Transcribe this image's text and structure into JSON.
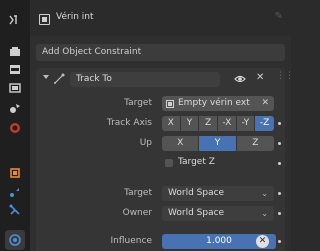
{
  "header": {
    "object_name": "Vérin int"
  },
  "add_constraint": {
    "label": "Add Object Constraint"
  },
  "constraint": {
    "name": "Track To",
    "target_label": "Target",
    "target_value": "Empty vérin ext",
    "track_axis_label": "Track Axis",
    "track_axis_options": [
      "X",
      "Y",
      "Z",
      "-X",
      "-Y",
      "-Z"
    ],
    "track_axis_selected": "-Z",
    "up_label": "Up",
    "up_options": [
      "X",
      "Y",
      "Z"
    ],
    "up_selected": "Y",
    "target_z_label": "Target Z",
    "target_space_label": "Target",
    "target_space_value": "World Space",
    "owner_space_label": "Owner",
    "owner_space_value": "World Space",
    "influence_label": "Influence",
    "influence_value": "1.000"
  },
  "colors": {
    "accent": "#4772b3",
    "panel": "#2f2f2f",
    "sidebar": "#1f1f1f"
  }
}
